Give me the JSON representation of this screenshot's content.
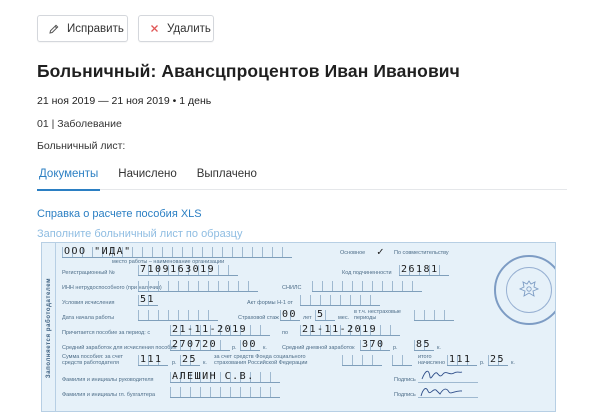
{
  "toolbar": {
    "edit_label": "Исправить",
    "delete_label": "Удалить",
    "edit_icon": "pencil-icon",
    "delete_icon": "close-icon"
  },
  "page": {
    "title": "Больничный: Авансцпроцентов Иван Иванович",
    "dates": "21 ноя 2019 — 21 ноя 2019 • 1 день",
    "diagnosis": "01 | Заболевание",
    "sheet_label": "Больничный лист:"
  },
  "tabs": [
    {
      "label": "Документы",
      "active": true
    },
    {
      "label": "Начислено",
      "active": false
    },
    {
      "label": "Выплачено",
      "active": false
    }
  ],
  "links": {
    "report": "Справка о расчете пособия XLS",
    "sample": "Заполните больничный лист по образцу"
  },
  "form": {
    "side_title": "Заполняется работодателем",
    "employer": "ООО \"ИДА\"",
    "employer_caption": "место работы – наименование организации",
    "main_label": "Основное",
    "part_label": "По совместительству",
    "reg_label": "Регистрационный №",
    "reg_number": "7109163019",
    "subord_label": "Код подчиненности",
    "subord_code": "26181",
    "inn_label": "ИНН нетрудоспособного (при наличии)",
    "snils_label": "СНИЛС",
    "conditions_label": "Условия исчисления",
    "conditions_code": "51",
    "act_label": "Акт формы Н-1 от",
    "date_start_label": "Дата начала работы",
    "insurance_label": "Страховой стаж",
    "years": "00",
    "years_unit": "лет",
    "months": "5",
    "months_unit": "мес.",
    "nonins_label": "в т.ч. нестраховые периоды",
    "period_label": "Причитается пособие за период: с",
    "period_from": "21-11-2019",
    "period_to_label": "по",
    "period_to": "21-11-2019",
    "avg_label": "Средний заработок для исчисления пособия",
    "avg_rub": "270720",
    "avg_kop": "00",
    "daily_label": "Средний дневной заработок",
    "daily_rub": "370",
    "daily_kop": "85",
    "rub": "р.",
    "kop": "к.",
    "emp_amount_label": "Сумма пособия: за счет средств работодателя",
    "emp_rub": "111",
    "emp_kop": "25",
    "fss_label": "за счет средств Фонда социального страхования Российской Федерации",
    "total_label": "итого начислено",
    "total_rub": "111",
    "total_kop": "25",
    "head_label": "Фамилия и инициалы руководителя",
    "head_name": "АЛЕШИН С.В.",
    "acct_label": "Фамилия и инициалы гл. бухгалтера",
    "sign_label": "Подпись",
    "sign_label2": "Подпись",
    "stamp_icon": "stamp-icon"
  }
}
